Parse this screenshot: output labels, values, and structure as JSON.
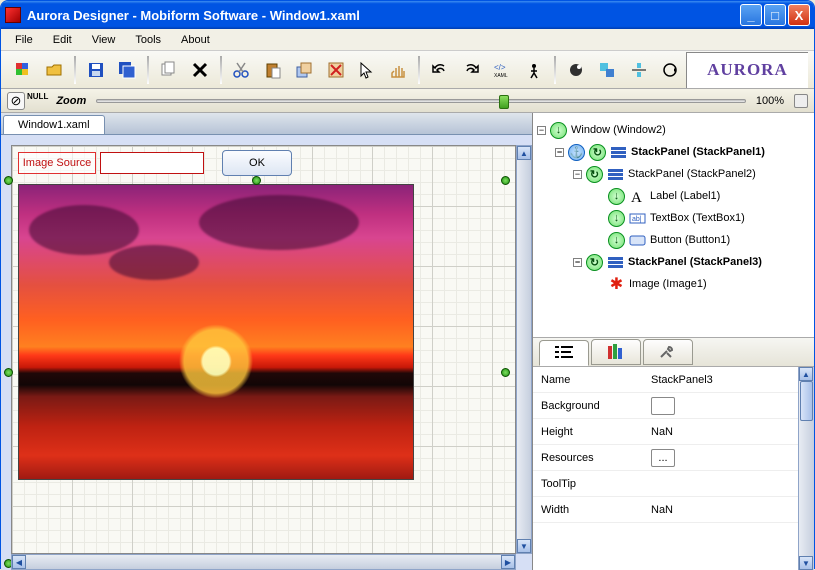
{
  "window": {
    "title": "Aurora Designer - Mobiform Software - Window1.xaml",
    "minimize": "_",
    "maximize": "□",
    "close": "X"
  },
  "menu": [
    "File",
    "Edit",
    "View",
    "Tools",
    "About"
  ],
  "zoom": {
    "null_label": "NULL",
    "label": "Zoom",
    "percent": "100%"
  },
  "logo": "AURORA",
  "tabs": {
    "file": "Window1.xaml"
  },
  "designer": {
    "image_source_label": "Image Source",
    "ok_label": "OK"
  },
  "tree": [
    {
      "depth": 0,
      "exp": "-",
      "icons": [
        "down"
      ],
      "label": "Window (Window2)",
      "bold": false
    },
    {
      "depth": 1,
      "exp": "-",
      "icons": [
        "anchor",
        "cycle",
        "stack"
      ],
      "label": "StackPanel (StackPanel1)",
      "bold": true
    },
    {
      "depth": 2,
      "exp": "-",
      "icons": [
        "cycle",
        "stack"
      ],
      "label": "StackPanel (StackPanel2)",
      "bold": false
    },
    {
      "depth": 3,
      "exp": "",
      "icons": [
        "down",
        "typeA"
      ],
      "label": "Label (Label1)",
      "bold": false
    },
    {
      "depth": 3,
      "exp": "",
      "icons": [
        "down",
        "textbox"
      ],
      "label": "TextBox (TextBox1)",
      "bold": false
    },
    {
      "depth": 3,
      "exp": "",
      "icons": [
        "down",
        "button"
      ],
      "label": "Button (Button1)",
      "bold": false
    },
    {
      "depth": 2,
      "exp": "-",
      "icons": [
        "cycle",
        "stack"
      ],
      "label": "StackPanel (StackPanel3)",
      "bold": true
    },
    {
      "depth": 3,
      "exp": "",
      "icons": [
        "star"
      ],
      "label": "Image (Image1)",
      "bold": false
    }
  ],
  "properties": {
    "rows": [
      {
        "label": "Name",
        "value": "StackPanel3",
        "type": "text"
      },
      {
        "label": "Background",
        "value": "",
        "type": "color"
      },
      {
        "label": "Height",
        "value": "NaN",
        "type": "text"
      },
      {
        "label": "Resources",
        "value": "...",
        "type": "button"
      },
      {
        "label": "ToolTip",
        "value": "",
        "type": "text"
      },
      {
        "label": "Width",
        "value": "NaN",
        "type": "text"
      }
    ]
  }
}
